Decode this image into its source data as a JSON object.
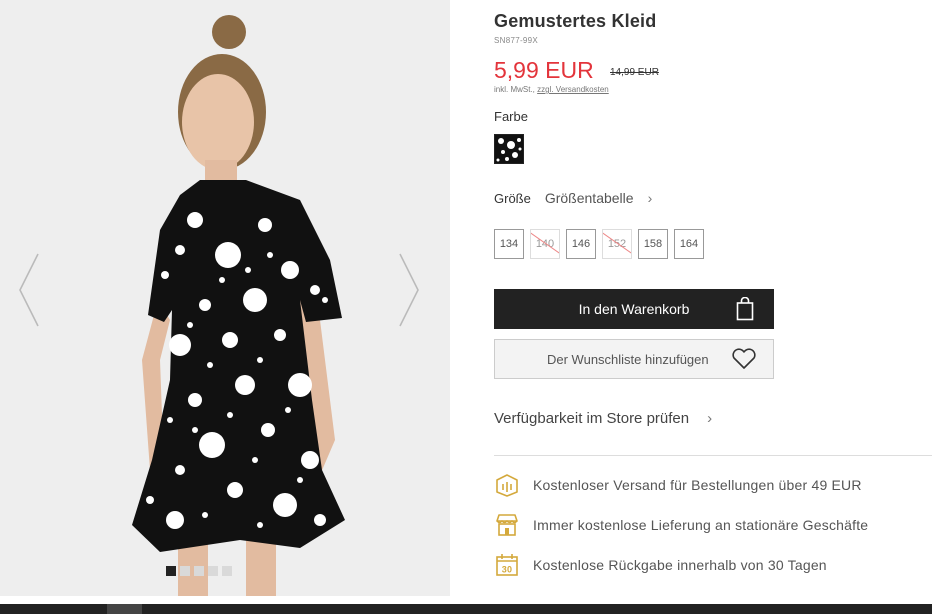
{
  "product": {
    "title": "Gemustertes Kleid",
    "sku": "SN877-99X",
    "price": "5,99 EUR",
    "old_price": "14,99 EUR",
    "tax_prefix": "inkl. MwSt., ",
    "tax_link": "zzgl. Versandkosten",
    "color_label": "Farbe",
    "size_label": "Größe",
    "size_table_label": "Größentabelle",
    "sizes": [
      {
        "label": "134",
        "available": true
      },
      {
        "label": "140",
        "available": false
      },
      {
        "label": "146",
        "available": true
      },
      {
        "label": "152",
        "available": false
      },
      {
        "label": "158",
        "available": true
      },
      {
        "label": "164",
        "available": true
      }
    ]
  },
  "actions": {
    "add_to_cart": "In den Warenkorb",
    "wishlist": "Der Wunschliste hinzufügen",
    "store_check": "Verfügbarkeit im Store prüfen"
  },
  "benefits": [
    {
      "icon": "shipping-box-icon",
      "text": "Kostenloser Versand für Bestellungen über 49 EUR"
    },
    {
      "icon": "store-icon",
      "text": "Immer kostenlose Lieferung an stationäre Geschäfte"
    },
    {
      "icon": "calendar-30-icon",
      "text": "Kostenlose Rückgabe innerhalb von 30 Tagen",
      "icon_text": "30"
    }
  ],
  "gallery": {
    "slide_count": 5,
    "active_slide": 1
  },
  "colors": {
    "price": "#e3343b",
    "button_dark": "#222222",
    "benefit_icon": "#d4a93c"
  }
}
